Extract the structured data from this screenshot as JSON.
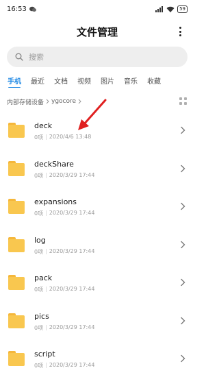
{
  "status": {
    "time": "16:53",
    "battery": "59"
  },
  "header": {
    "title": "文件管理"
  },
  "search": {
    "placeholder": "搜索"
  },
  "tabs": [
    {
      "label": "手机"
    },
    {
      "label": "最近"
    },
    {
      "label": "文档"
    },
    {
      "label": "视频"
    },
    {
      "label": "图片"
    },
    {
      "label": "音乐"
    },
    {
      "label": "收藏"
    }
  ],
  "breadcrumb": {
    "root": "内部存储设备",
    "current": "ygocore"
  },
  "files": [
    {
      "name": "deck",
      "count": "0项",
      "date": "2020/4/6 13:48"
    },
    {
      "name": "deckShare",
      "count": "0项",
      "date": "2020/3/29 17:44"
    },
    {
      "name": "expansions",
      "count": "0项",
      "date": "2020/3/29 17:44"
    },
    {
      "name": "log",
      "count": "0项",
      "date": "2020/3/29 17:44"
    },
    {
      "name": "pack",
      "count": "0项",
      "date": "2020/3/29 17:44"
    },
    {
      "name": "pics",
      "count": "0项",
      "date": "2020/3/29 17:44"
    },
    {
      "name": "script",
      "count": "0项",
      "date": "2020/3/29 17:44"
    }
  ],
  "colors": {
    "accent": "#1e88e5",
    "folder": "#f9c74f",
    "annotation_arrow": "#e02020"
  }
}
